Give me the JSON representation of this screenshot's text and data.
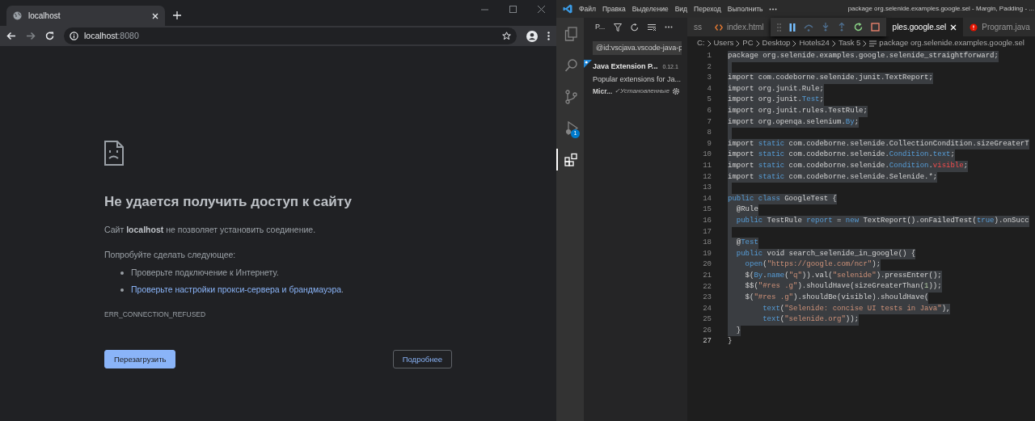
{
  "browser": {
    "tab": {
      "title": "localhost",
      "selected": true
    },
    "address": {
      "host": "localhost",
      "port": ":8080"
    },
    "error_page": {
      "heading": "Не удается получить доступ к сайту",
      "message": "Сайт **localhost** не позволяет установить соединение.",
      "suggestions_title": "Попробуйте сделать следующее:",
      "suggestions": [
        {
          "kind": "text",
          "text": "Проверьте подключение к Интернету."
        },
        {
          "kind": "link",
          "text": "Проверьте настройки прокси-сервера и брандмауэра",
          "tail": "."
        }
      ],
      "error_code": "ERR_CONNECTION_REFUSED",
      "buttons": [
        {
          "label": "Перезагрузить",
          "kind": "primary"
        },
        {
          "label": "Подробнее",
          "kind": "outline"
        }
      ]
    }
  },
  "editor_window": {
    "menu": [
      "Файл",
      "Правка",
      "Выделение",
      "Вид",
      "Переход",
      "Выполнить"
    ],
    "title": "package org.selenide.examples.google.sel - Margin, Padding - ...",
    "activity_bar": [
      {
        "kind": "files",
        "selected": false
      },
      {
        "kind": "search",
        "selected": false
      },
      {
        "kind": "source-control",
        "selected": false
      },
      {
        "kind": "debug",
        "selected": false,
        "badge": "1"
      },
      {
        "kind": "extensions",
        "selected": true
      }
    ],
    "sidebar": {
      "title": "P...",
      "search": {
        "value": "@id:vscjava.vscode-java-p"
      },
      "extensions": [
        {
          "name": "Java Extension P...",
          "version": "0.12.1",
          "description": "Popular extensions for Ja...",
          "publisher": "Micr...",
          "status": "✓Установленные"
        }
      ]
    },
    "tabs": [
      {
        "label": "ss",
        "kind": "plain",
        "selected": false
      },
      {
        "label": "index.html",
        "kind": "html",
        "selected": false
      },
      {
        "label": "ples.google.sel",
        "kind": "java",
        "selected": true
      },
      {
        "label": "Program.java",
        "kind": "error",
        "selected": false
      }
    ],
    "breadcrumb": [
      "C:",
      "Users",
      "PC",
      "Desktop",
      "Hotels24",
      "Task 5",
      "package org.selenide.examples.google.sel"
    ],
    "code": [
      {
        "number": "1",
        "selected": true,
        "tokens": [
          {
            "kind": "plain",
            "text": "package org.selenide.examples.google.selenide_straightforward;"
          }
        ]
      },
      {
        "number": "2",
        "selected": true
      },
      {
        "number": "3",
        "selected": true,
        "tokens": [
          {
            "kind": "plain",
            "text": "import com.codeborne.selenide.junit.TextReport;"
          }
        ]
      },
      {
        "number": "4",
        "selected": true,
        "tokens": [
          {
            "kind": "plain",
            "text": "import org.junit.Rule;"
          }
        ]
      },
      {
        "number": "5",
        "selected": true,
        "tokens": [
          {
            "kind": "plain",
            "text": "import org.junit."
          },
          {
            "kind": "keyword",
            "text": "Test"
          },
          {
            "kind": "plain",
            "text": ";"
          }
        ]
      },
      {
        "number": "6",
        "selected": true,
        "tokens": [
          {
            "kind": "plain",
            "text": "import org.junit.rules.TestRule;"
          }
        ]
      },
      {
        "number": "7",
        "selected": true,
        "tokens": [
          {
            "kind": "plain",
            "text": "import org.openqa.selenium."
          },
          {
            "kind": "keyword",
            "text": "By"
          },
          {
            "kind": "plain",
            "text": ";"
          }
        ]
      },
      {
        "number": "8",
        "selected": true
      },
      {
        "number": "9",
        "selected": true,
        "tokens": [
          {
            "kind": "plain",
            "text": "import "
          },
          {
            "kind": "keyword",
            "text": "static"
          },
          {
            "kind": "plain",
            "text": " com.codeborne.selenide.CollectionCondition.sizeGreaterT"
          }
        ]
      },
      {
        "number": "10",
        "selected": true,
        "tokens": [
          {
            "kind": "plain",
            "text": "import "
          },
          {
            "kind": "keyword",
            "text": "static"
          },
          {
            "kind": "plain",
            "text": " com.codeborne.selenide."
          },
          {
            "kind": "keyword",
            "text": "Condition"
          },
          {
            "kind": "plain",
            "text": "."
          },
          {
            "kind": "keyword",
            "text": "text"
          },
          {
            "kind": "plain",
            "text": ";"
          }
        ]
      },
      {
        "number": "11",
        "selected": true,
        "tokens": [
          {
            "kind": "plain",
            "text": "import "
          },
          {
            "kind": "keyword",
            "text": "static"
          },
          {
            "kind": "plain",
            "text": " com.codeborne.selenide."
          },
          {
            "kind": "keyword",
            "text": "Condition"
          },
          {
            "kind": "plain",
            "text": "."
          },
          {
            "kind": "error",
            "text": "visible"
          },
          {
            "kind": "plain",
            "text": ";"
          }
        ]
      },
      {
        "number": "12",
        "selected": true,
        "tokens": [
          {
            "kind": "plain",
            "text": "import "
          },
          {
            "kind": "keyword",
            "text": "static"
          },
          {
            "kind": "plain",
            "text": " com.codeborne.selenide.Selenide.*;"
          }
        ]
      },
      {
        "number": "13",
        "selected": true
      },
      {
        "number": "14",
        "selected": true,
        "tokens": [
          {
            "kind": "keyword",
            "text": "public"
          },
          {
            "kind": "keyword",
            "text": " class"
          },
          {
            "kind": "plain",
            "text": " GoogleTest {"
          }
        ]
      },
      {
        "number": "15",
        "selected": true,
        "tokens": [
          {
            "kind": "plain",
            "text": "  @Rule"
          }
        ]
      },
      {
        "number": "16",
        "selected": true,
        "tokens": [
          {
            "kind": "keyword",
            "text": "  public"
          },
          {
            "kind": "plain",
            "text": " TestRule "
          },
          {
            "kind": "keyword",
            "text": "report"
          },
          {
            "kind": "plain",
            "text": " = "
          },
          {
            "kind": "keyword",
            "text": "new"
          },
          {
            "kind": "plain",
            "text": " TextReport().onFailedTest("
          },
          {
            "kind": "keyword",
            "text": "true"
          },
          {
            "kind": "plain",
            "text": ").onSucc"
          }
        ]
      },
      {
        "number": "17",
        "selected": true
      },
      {
        "number": "18",
        "selected": true,
        "tokens": [
          {
            "kind": "plain",
            "text": "  @"
          },
          {
            "kind": "keyword",
            "text": "Test"
          }
        ]
      },
      {
        "number": "19",
        "selected": true,
        "tokens": [
          {
            "kind": "keyword",
            "text": "  public"
          },
          {
            "kind": "plain",
            "text": " void search_selenide_in_google() {"
          }
        ]
      },
      {
        "number": "20",
        "selected": true,
        "tokens": [
          {
            "kind": "keyword",
            "text": "    open"
          },
          {
            "kind": "plain",
            "text": "("
          },
          {
            "kind": "string",
            "text": "\"https://google.com/ncr\""
          },
          {
            "kind": "plain",
            "text": ");"
          }
        ]
      },
      {
        "number": "21",
        "selected": true,
        "tokens": [
          {
            "kind": "plain",
            "text": "    $("
          },
          {
            "kind": "keyword",
            "text": "By"
          },
          {
            "kind": "plain",
            "text": "."
          },
          {
            "kind": "keyword",
            "text": "name"
          },
          {
            "kind": "plain",
            "text": "("
          },
          {
            "kind": "string",
            "text": "\"q\""
          },
          {
            "kind": "plain",
            "text": ")).val("
          },
          {
            "kind": "string",
            "text": "\"selenide\""
          },
          {
            "kind": "plain",
            "text": ").pressEnter();"
          }
        ]
      },
      {
        "number": "22",
        "selected": true,
        "tokens": [
          {
            "kind": "plain",
            "text": "    $$("
          },
          {
            "kind": "string",
            "text": "\"#res .g\""
          },
          {
            "kind": "plain",
            "text": ").shouldHave(sizeGreaterThan("
          },
          {
            "kind": "number",
            "text": "1"
          },
          {
            "kind": "plain",
            "text": "));"
          }
        ]
      },
      {
        "number": "23",
        "selected": true,
        "tokens": [
          {
            "kind": "plain",
            "text": "    $("
          },
          {
            "kind": "string",
            "text": "\"#res .g\""
          },
          {
            "kind": "plain",
            "text": ").shouldBe(visible).shouldHave("
          }
        ]
      },
      {
        "number": "24",
        "selected": true,
        "tokens": [
          {
            "kind": "keyword",
            "text": "        text"
          },
          {
            "kind": "plain",
            "text": "("
          },
          {
            "kind": "string",
            "text": "\"Selenide: concise UI tests in Java\""
          },
          {
            "kind": "plain",
            "text": "),"
          }
        ]
      },
      {
        "number": "25",
        "selected": true,
        "tokens": [
          {
            "kind": "keyword",
            "text": "        text"
          },
          {
            "kind": "plain",
            "text": "("
          },
          {
            "kind": "string",
            "text": "\"selenide.org\""
          },
          {
            "kind": "plain",
            "text": "));"
          }
        ]
      },
      {
        "number": "26",
        "selected": true,
        "tokens": [
          {
            "kind": "plain",
            "text": "  }"
          }
        ]
      },
      {
        "number": "27",
        "selected": false,
        "tokens": [
          {
            "kind": "plain",
            "text": "}"
          }
        ]
      }
    ]
  }
}
